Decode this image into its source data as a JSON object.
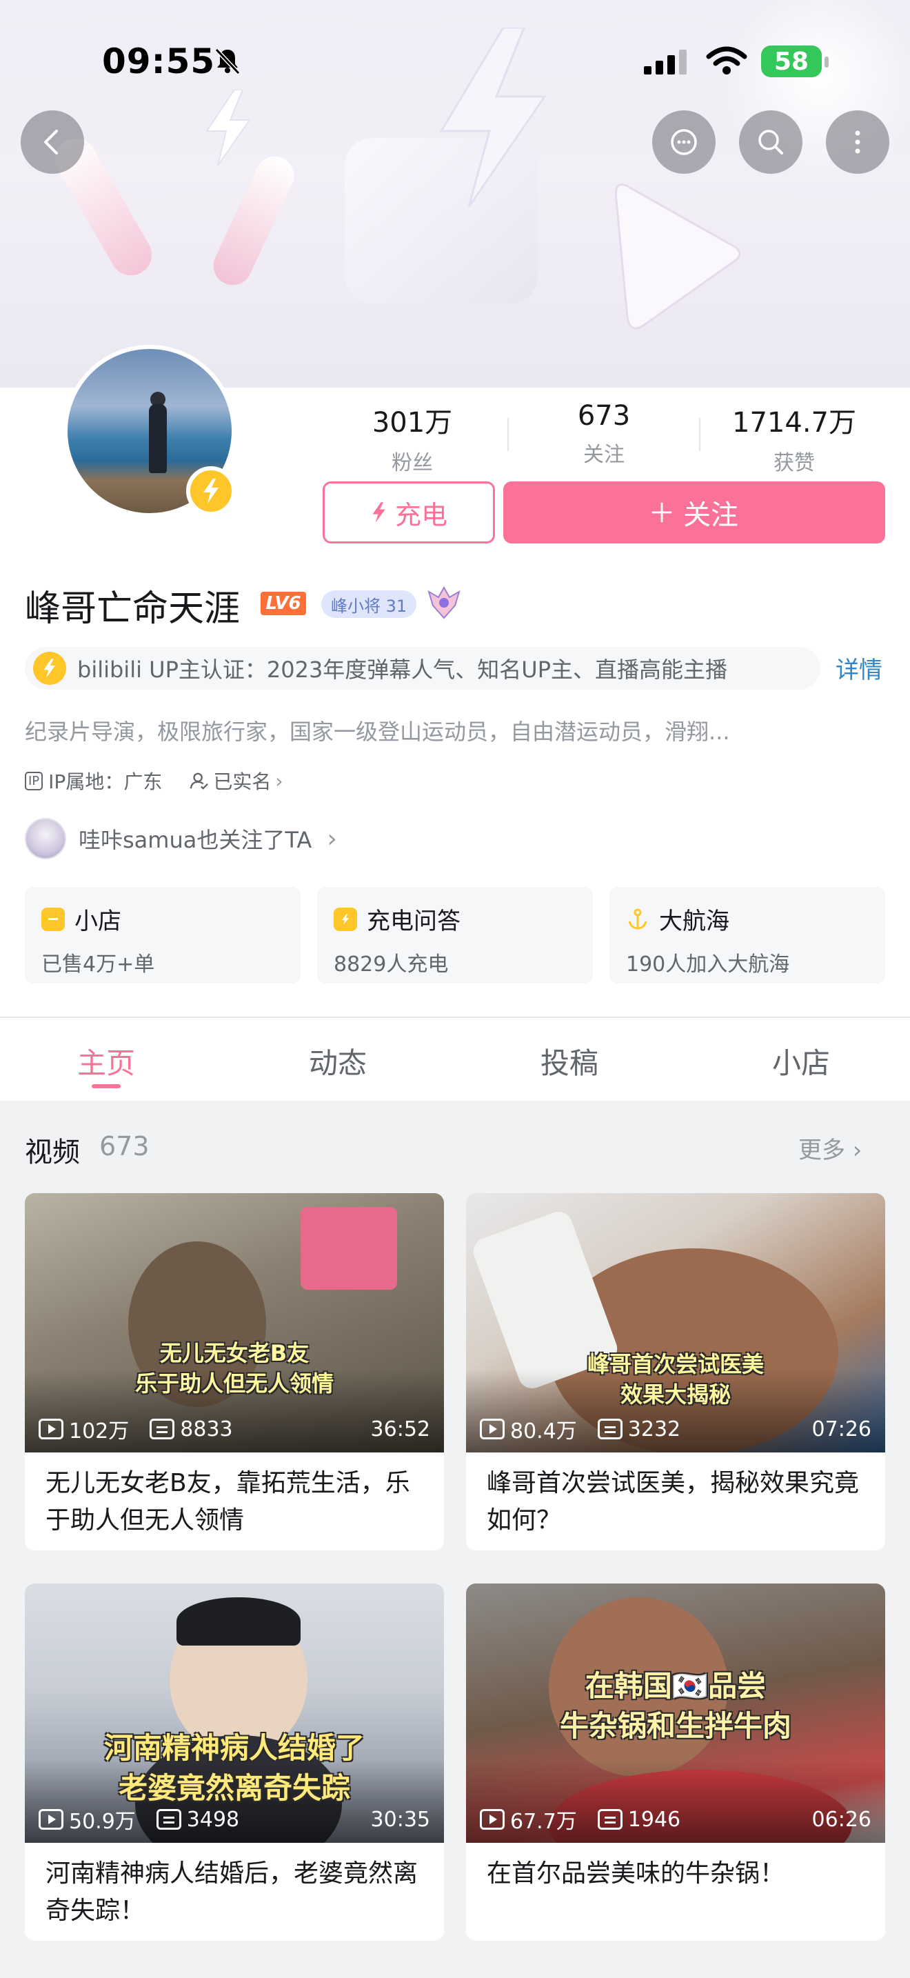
{
  "status_bar": {
    "time": "09:55",
    "battery": "58"
  },
  "profile": {
    "name": "峰哥亡命天涯",
    "level": "LV6",
    "fan_medal": "峰小将 31",
    "stats": [
      {
        "value": "301万",
        "label": "粉丝"
      },
      {
        "value": "673",
        "label": "关注"
      },
      {
        "value": "1714.7万",
        "label": "获赞"
      }
    ],
    "charge_label": "充电",
    "follow_label": "关注",
    "certification": "bilibili UP主认证：2023年度弹幕人气、知名UP主、直播高能主播",
    "cert_detail": "详情",
    "bio": "纪录片导演，极限旅行家，国家一级登山运动员，自由潜运动员，滑翔...",
    "ip_tag": "IP",
    "ip_location": "IP属地：广东",
    "real_name": "已实名",
    "mutual_follow": "哇咔samua也关注了TA"
  },
  "features": [
    {
      "title": "小店",
      "sub": "已售4万+单"
    },
    {
      "title": "充电问答",
      "sub": "8829人充电"
    },
    {
      "title": "大航海",
      "sub": "190人加入大航海"
    }
  ],
  "tabs": [
    {
      "label": "主页",
      "active": true
    },
    {
      "label": "动态",
      "active": false
    },
    {
      "label": "投稿",
      "active": false
    },
    {
      "label": "小店",
      "active": false
    }
  ],
  "videos_section": {
    "title": "视频",
    "count": "673",
    "more": "更多"
  },
  "videos": [
    {
      "caption": [
        "无儿无女老B友",
        "乐于助人但无人领情"
      ],
      "views": "102万",
      "danmaku": "8833",
      "duration": "36:52",
      "title": "无儿无女老B友，靠拓荒生活，乐于助人但无人领情"
    },
    {
      "caption": [
        "峰哥首次尝试医美",
        "效果大揭秘"
      ],
      "views": "80.4万",
      "danmaku": "3232",
      "duration": "07:26",
      "title": "峰哥首次尝试医美，揭秘效果究竟如何？"
    },
    {
      "caption": [
        "河南精神病人结婚了",
        "老婆竟然离奇失踪"
      ],
      "views": "50.9万",
      "danmaku": "3498",
      "duration": "30:35",
      "title": "河南精神病人结婚后，老婆竟然离奇失踪！"
    },
    {
      "caption": [
        "在韩国🇰🇷品尝",
        "牛杂锅和生拌牛肉"
      ],
      "views": "67.7万",
      "danmaku": "1946",
      "duration": "06:26",
      "title": "在首尔品尝美味的牛杂锅！"
    }
  ],
  "colors": {
    "accent": "#fb7299",
    "gold": "#ffc62a",
    "link": "#2f86c8"
  }
}
